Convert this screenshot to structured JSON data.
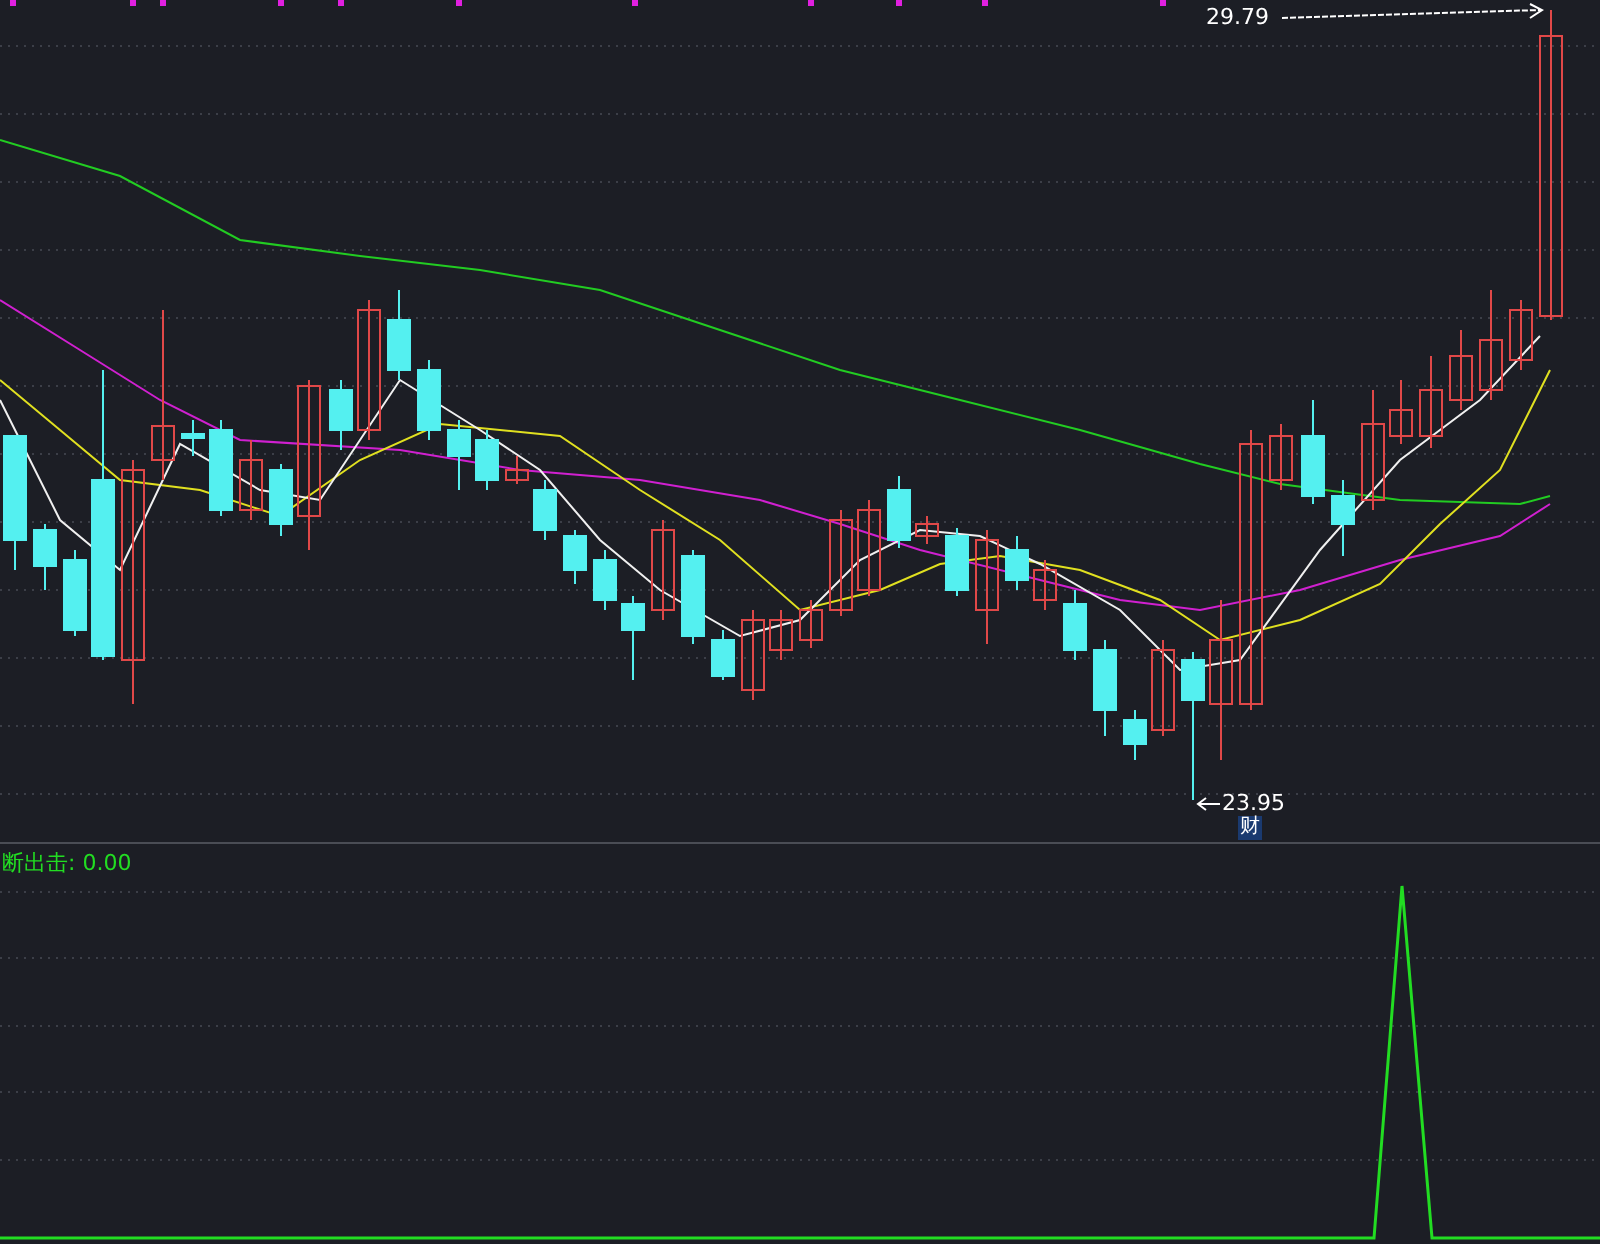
{
  "price_chart": {
    "high_label": "29.79",
    "low_label": "23.95",
    "low_tag": "财"
  },
  "indicator": {
    "label": "断出击: 0.00"
  }
}
